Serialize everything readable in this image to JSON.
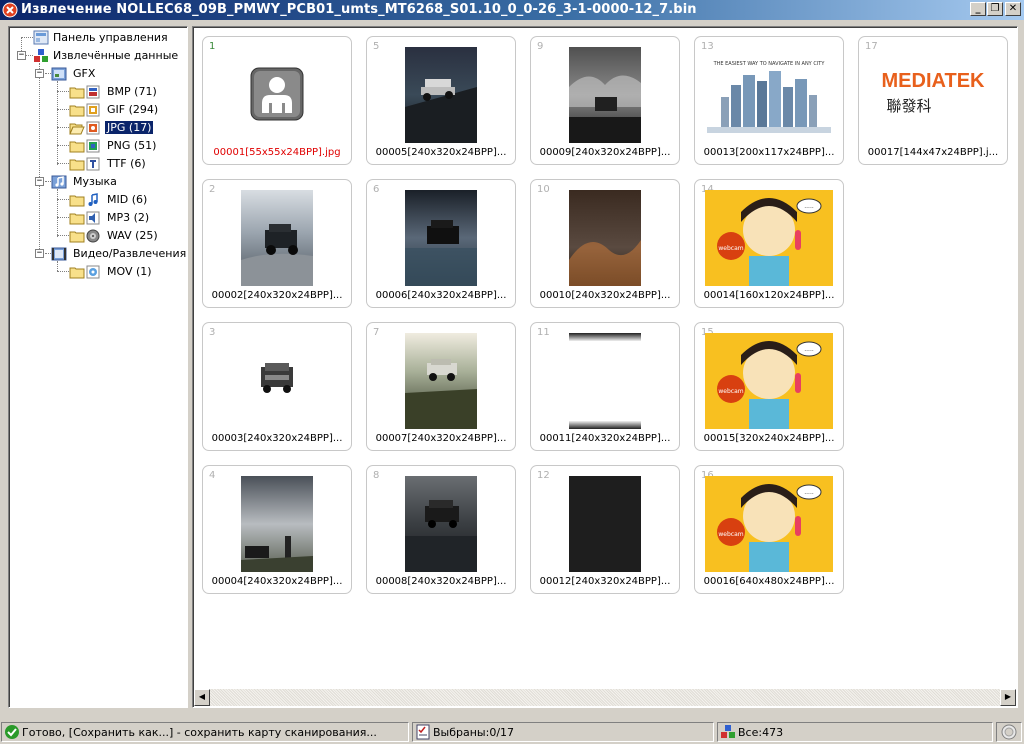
{
  "window": {
    "title": "Извлечение NOLLEC68_09B_PMWY_PCB01_umts_MT6268_S01.10_0_0-26_3-1-0000-12_7.bin",
    "buttons": {
      "minimize": "_",
      "restore": "❐",
      "close": "✕"
    }
  },
  "tree": {
    "control_panel": "Панель управления",
    "extracted": "Извлечённые данные",
    "gfx": "GFX",
    "bmp": "BMP (71)",
    "gif": "GIF (294)",
    "jpg": "JPG (17)",
    "png": "PNG (51)",
    "ttf": "TTF (6)",
    "music": "Музыка",
    "mid": "MID (6)",
    "mp3": "MP3 (2)",
    "wav": "WAV (25)",
    "video": "Видео/Развлечения",
    "mov": "MOV (1)",
    "selected": "jpg"
  },
  "thumbnails": [
    {
      "num": "1",
      "caption": "00001[55x55x24BPP].jpg"
    },
    {
      "num": "5",
      "caption": "00005[240x320x24BPP]..."
    },
    {
      "num": "9",
      "caption": "00009[240x320x24BPP]..."
    },
    {
      "num": "13",
      "caption": "00013[200x117x24BPP]..."
    },
    {
      "num": "17",
      "caption": "00017[144x47x24BPP].j..."
    },
    {
      "num": "2",
      "caption": "00002[240x320x24BPP]..."
    },
    {
      "num": "6",
      "caption": "00006[240x320x24BPP]..."
    },
    {
      "num": "10",
      "caption": "00010[240x320x24BPP]..."
    },
    {
      "num": "14",
      "caption": "00014[160x120x24BPP]..."
    },
    {
      "num": "3",
      "caption": "00003[240x320x24BPP]..."
    },
    {
      "num": "7",
      "caption": "00007[240x320x24BPP]..."
    },
    {
      "num": "11",
      "caption": "00011[240x320x24BPP]..."
    },
    {
      "num": "15",
      "caption": "00015[320x240x24BPP]..."
    },
    {
      "num": "4",
      "caption": "00004[240x320x24BPP]..."
    },
    {
      "num": "8",
      "caption": "00008[240x320x24BPP]..."
    },
    {
      "num": "12",
      "caption": "00012[240x320x24BPP]..."
    },
    {
      "num": "16",
      "caption": "00016[640x480x24BPP]..."
    }
  ],
  "image_text": {
    "city_tagline": "THE EASIEST WAY TO NAVIGATE IN ANY CITY",
    "mediatek_logo": "MEDIATEK",
    "mediatek_chinese": "聯發科",
    "webcam_label": "webcam",
    "speech_dots": "....."
  },
  "scrollbar": {
    "left_arrow": "◀",
    "right_arrow": "▶"
  },
  "status": {
    "ready": "Готово, [Сохранить как...] - сохранить карту сканирования...",
    "selected": "Выбраны:0/17",
    "total": "Все:473"
  },
  "colors": {
    "title_bar": "#0a246a",
    "selection": "#0a246a",
    "caption_highlight": "#e00000",
    "mediatek_orange": "#e8601c"
  }
}
